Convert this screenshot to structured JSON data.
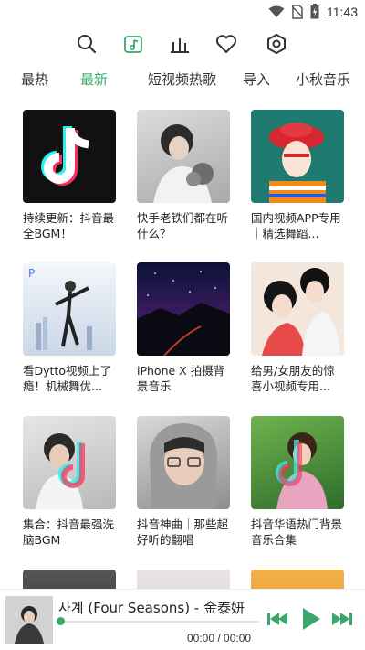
{
  "status": {
    "time": "11:43"
  },
  "toolbar": {
    "icons": [
      "search-icon",
      "music-note-icon",
      "bar-chart-icon",
      "heart-icon",
      "settings-icon"
    ]
  },
  "tabs": [
    {
      "label": "最热",
      "active": false
    },
    {
      "label": "最新",
      "active": true
    },
    {
      "label": "短视频热歌",
      "active": false
    },
    {
      "label": "导入",
      "active": false
    },
    {
      "label": "小秋音乐",
      "active": false
    }
  ],
  "cards": [
    {
      "title": "持续更新：抖音最全BGM！"
    },
    {
      "title": "快手老铁们都在听什么？"
    },
    {
      "title": "国内视频APP专用｜精选舞蹈..."
    },
    {
      "title": "看Dytto视频上了瘾！机械舞优..."
    },
    {
      "title": "iPhone X 拍摄背景音乐"
    },
    {
      "title": "给男/女朋友的惊喜小视频专用..."
    },
    {
      "title": "集合：抖音最强洗脑BGM"
    },
    {
      "title": "抖音神曲｜那些超好听的翻唱"
    },
    {
      "title": "抖音华语热门背景音乐合集"
    }
  ],
  "player": {
    "song": "사계 (Four Seasons) - 金泰妍",
    "time": "00:00 / 00:00",
    "progress": 0
  },
  "colors": {
    "accent": "#3aa86a"
  }
}
